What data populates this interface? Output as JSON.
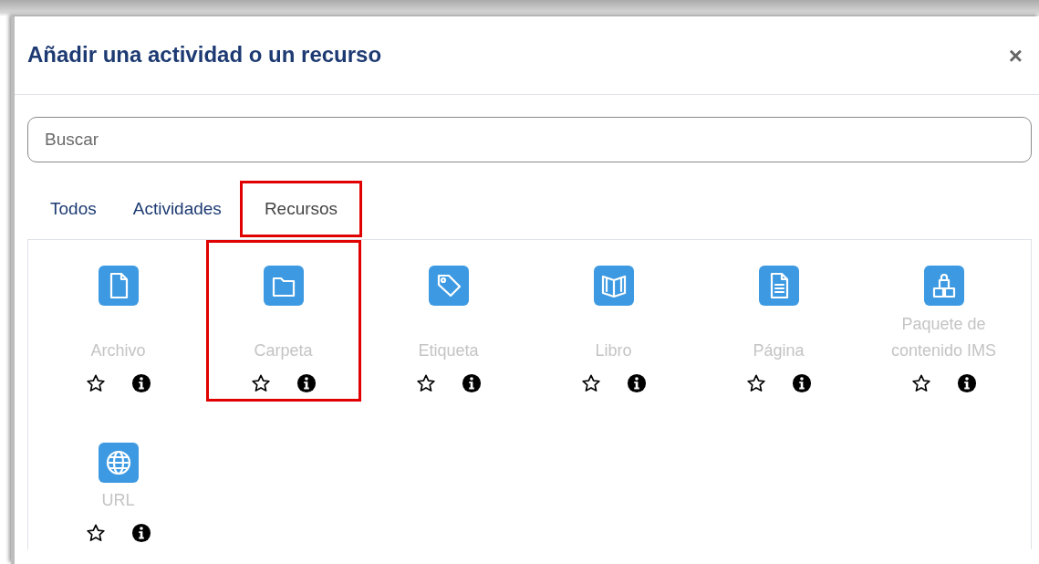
{
  "dialog": {
    "title": "Añadir una actividad o un recurso",
    "close": "×"
  },
  "search": {
    "placeholder": "Buscar"
  },
  "tabs": [
    {
      "label": "Todos",
      "selected": false,
      "highlighted": false
    },
    {
      "label": "Actividades",
      "selected": false,
      "highlighted": false
    },
    {
      "label": "Recursos",
      "selected": true,
      "highlighted": true
    }
  ],
  "items": [
    {
      "name": "Archivo",
      "kind": "file",
      "starred": false,
      "highlighted": false
    },
    {
      "name": "Carpeta",
      "kind": "folder",
      "starred": false,
      "highlighted": true
    },
    {
      "name": "Etiqueta",
      "kind": "tag",
      "starred": false,
      "highlighted": false
    },
    {
      "name": "Libro",
      "kind": "book",
      "starred": false,
      "highlighted": false
    },
    {
      "name": "Página",
      "kind": "page",
      "starred": false,
      "highlighted": false
    },
    {
      "name": "Paquete de contenido IMS",
      "kind": "package",
      "starred": false,
      "highlighted": false
    },
    {
      "name": "URL",
      "kind": "globe",
      "starred": false,
      "highlighted": false
    }
  ]
}
